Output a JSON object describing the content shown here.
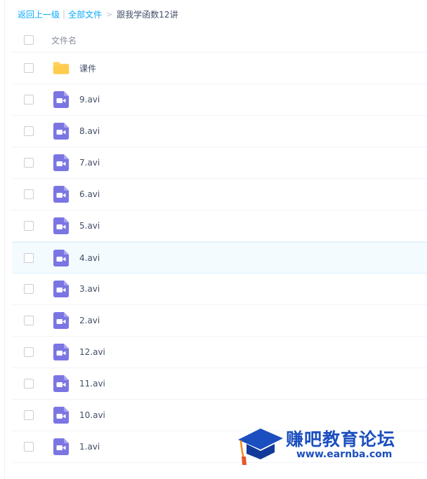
{
  "breadcrumb": {
    "back": "返回上一级",
    "divider": "|",
    "all_files": "全部文件",
    "separator": ">",
    "current": "跟我学函数12讲"
  },
  "list_header": {
    "name_label": "文件名"
  },
  "files": [
    {
      "name": "课件",
      "type": "folder"
    },
    {
      "name": "9.avi",
      "type": "video"
    },
    {
      "name": "8.avi",
      "type": "video"
    },
    {
      "name": "7.avi",
      "type": "video"
    },
    {
      "name": "6.avi",
      "type": "video"
    },
    {
      "name": "5.avi",
      "type": "video"
    },
    {
      "name": "4.avi",
      "type": "video",
      "hovered": true
    },
    {
      "name": "3.avi",
      "type": "video"
    },
    {
      "name": "2.avi",
      "type": "video"
    },
    {
      "name": "12.avi",
      "type": "video"
    },
    {
      "name": "11.avi",
      "type": "video"
    },
    {
      "name": "10.avi",
      "type": "video"
    },
    {
      "name": "1.avi",
      "type": "video"
    }
  ],
  "icons": {
    "folder": "folder-icon",
    "video": "video-file-icon"
  },
  "colors": {
    "link": "#09aaff",
    "video_icon": "#7b75e3",
    "folder_icon": "#ffd25e",
    "hover_row": "#f4fbff",
    "watermark": "#1b4fbf"
  },
  "watermark": {
    "title": "赚吧教育论坛",
    "url": "www.earnba.com"
  }
}
